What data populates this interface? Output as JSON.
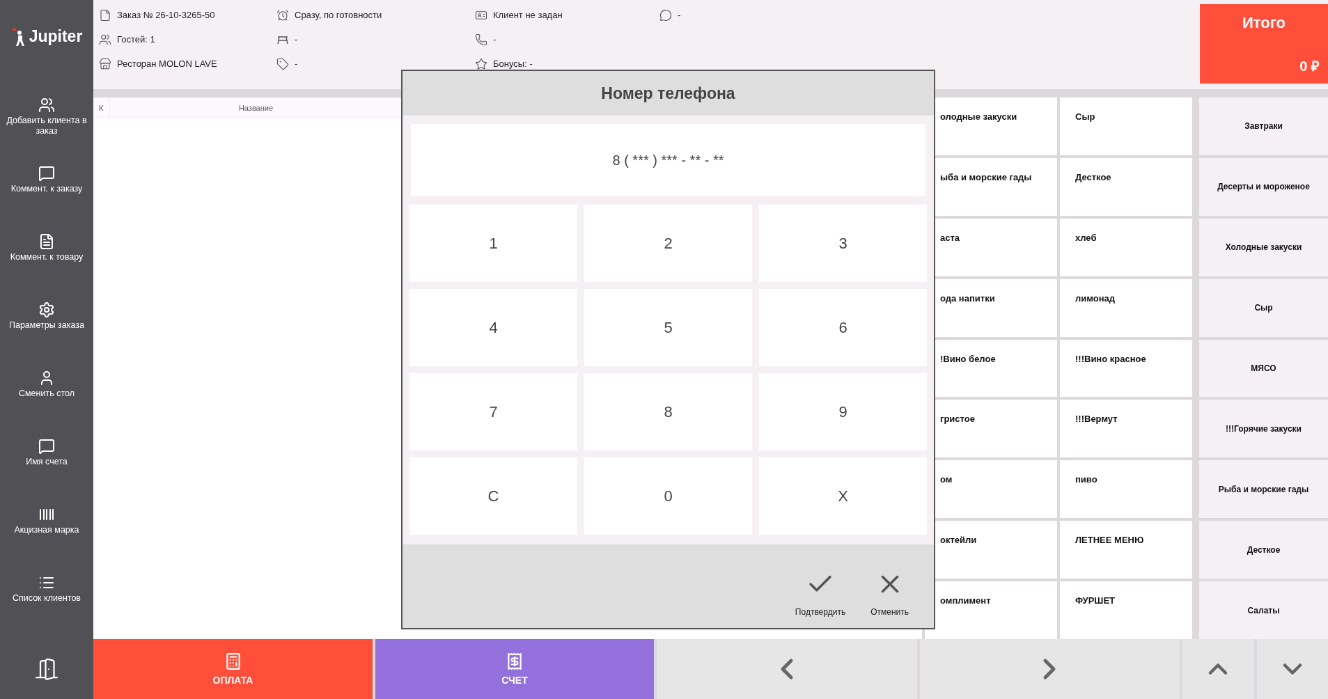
{
  "sidebar": {
    "logo": "Jupiter",
    "items": [
      {
        "label": "Добавить клиента в заказ"
      },
      {
        "label": "Коммент. к заказу"
      },
      {
        "label": "Коммент. к товару"
      },
      {
        "label": "Параметры заказа"
      },
      {
        "label": "Сменить стол"
      },
      {
        "label": "Имя счета"
      },
      {
        "label": "Акцизная марка"
      },
      {
        "label": "Список клиентов"
      }
    ]
  },
  "header": {
    "columns": [
      [
        "Заказ № 26-10-3265-50",
        "Гостей: 1",
        "Ресторан MOLON LAVE"
      ],
      [
        "Сразу, по готовности",
        "-",
        "-"
      ],
      [
        "Клиент не задан",
        "-",
        "Бонусы: -"
      ],
      [
        "-"
      ]
    ],
    "total": {
      "label": "Итого",
      "amount": "0",
      "currency": "₽"
    }
  },
  "order_table": {
    "columns": [
      "К",
      "Название"
    ]
  },
  "products": [
    "олодные закуски",
    "Сыр",
    "ыба и морские гады",
    "Десткое",
    "аста",
    "хлеб",
    "ода напитки",
    "лимонад",
    "!Вино белое",
    "!!!Вино красное",
    "гристое",
    "!!!Вермут",
    "ом",
    "пиво",
    "октейли",
    "ЛЕТНЕЕ МЕНЮ",
    "омплимент",
    "ФУРШЕТ"
  ],
  "categories": [
    "Завтраки",
    "Десерты и мороженое",
    "Холодные закуски",
    "Сыр",
    "МЯСО",
    "!!!Горячие закуски",
    "Рыба и морские гады",
    "Десткое",
    "Салаты"
  ],
  "modal": {
    "title": "Номер телефона",
    "display": "8 ( *** ) *** - ** - **",
    "keys": [
      "1",
      "2",
      "3",
      "4",
      "5",
      "6",
      "7",
      "8",
      "9",
      "C",
      "0",
      "X"
    ],
    "actions": [
      {
        "kind": "confirm",
        "label": "Подтвердить"
      },
      {
        "kind": "cancel",
        "label": "Отменить"
      }
    ]
  },
  "bottom": {
    "pay": "ОПЛАТА",
    "bill": "СЧЕТ"
  }
}
